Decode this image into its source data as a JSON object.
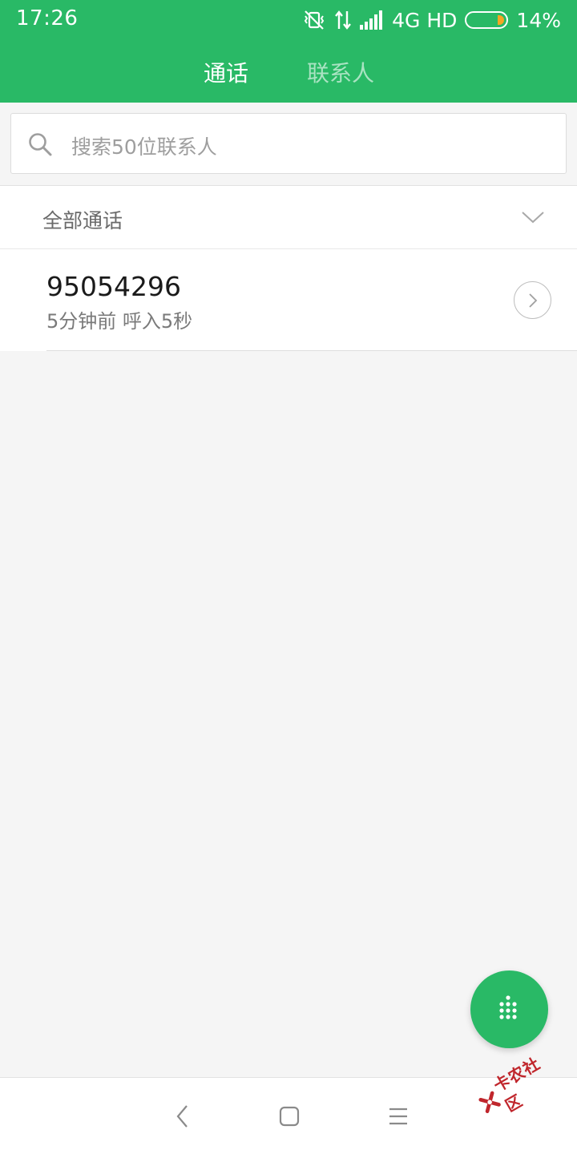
{
  "status_bar": {
    "time": "17:26",
    "network": "4G HD",
    "battery": "14%",
    "battery_level": 0.14,
    "icons": [
      "vibrate-off-icon",
      "data-arrows-icon",
      "signal-icon",
      "battery-icon"
    ]
  },
  "tabs": [
    {
      "label": "通话",
      "active": true
    },
    {
      "label": "联系人",
      "active": false
    }
  ],
  "search": {
    "placeholder": "搜索50位联系人",
    "icon": "search-icon"
  },
  "filter": {
    "label": "全部通话",
    "icon": "chevron-down-icon"
  },
  "calls": [
    {
      "number": "95054296",
      "meta": "5分钟前 呼入5秒"
    }
  ],
  "fab": {
    "icon": "dialpad-icon"
  },
  "nav": {
    "icons": [
      "back-icon",
      "home-icon",
      "menu-icon"
    ]
  },
  "watermark": {
    "text": "卡农社区"
  },
  "colors": {
    "accent": "#29b966",
    "background": "#f5f5f5",
    "battery_fill": "#f5a623",
    "watermark": "#c0262c"
  }
}
